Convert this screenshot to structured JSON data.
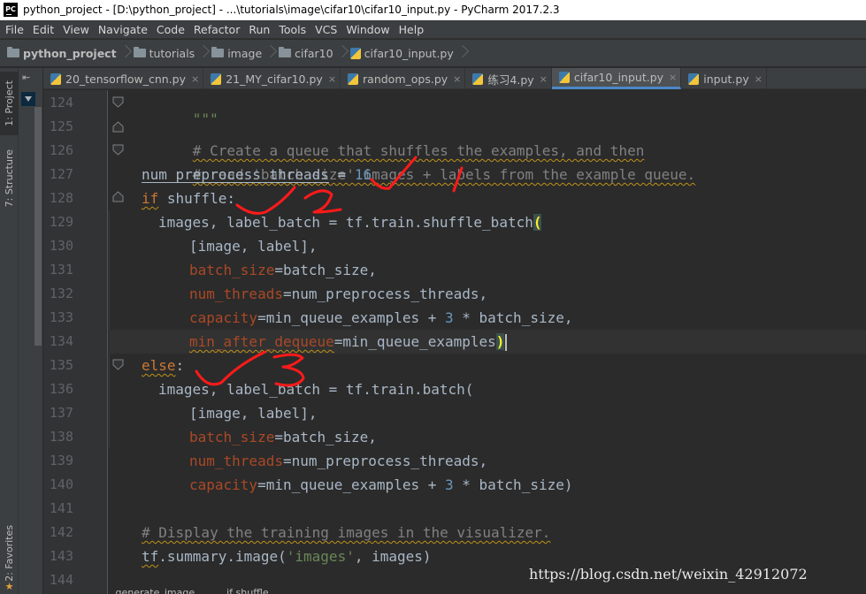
{
  "window": {
    "title": "python_project - [D:\\python_project] - ...\\tutorials\\image\\cifar10\\cifar10_input.py - PyCharm 2017.2.3",
    "logo_text": "PC"
  },
  "menu": [
    "File",
    "Edit",
    "View",
    "Navigate",
    "Code",
    "Refactor",
    "Run",
    "Tools",
    "VCS",
    "Window",
    "Help"
  ],
  "breadcrumb": [
    "python_project",
    "tutorials",
    "image",
    "cifar10",
    "cifar10_input.py"
  ],
  "tool_strip": {
    "project_tab": "1: Project",
    "structure_tab": "7: Structure",
    "favorites_tab": "2: Favorites"
  },
  "tabs": [
    {
      "label": "20_tensorflow_cnn.py",
      "active": false
    },
    {
      "label": "21_MY_cifar10.py",
      "active": false
    },
    {
      "label": "random_ops.py",
      "active": false
    },
    {
      "label": "练习4.py",
      "active": false
    },
    {
      "label": "cifar10_input.py",
      "active": true
    },
    {
      "label": "input.py",
      "active": false
    }
  ],
  "editor": {
    "line_numbers": [
      "124",
      "125",
      "126",
      "127",
      "128",
      "129",
      "130",
      "131",
      "132",
      "133",
      "134",
      "135",
      "136",
      "137",
      "138",
      "139",
      "140",
      "141",
      "142",
      "143",
      "144"
    ],
    "partial_top": "\"\"\"",
    "lines": {
      "l125": "# Create a queue that shuffles the examples, and then",
      "l126": "# read 'batch_size' images + labels from the example queue.",
      "l127_var": "num_preprocess_threads",
      "l127_op": " = ",
      "l127_num": "16",
      "l128_kw": "if",
      "l128_rest": " shuffle:",
      "l129_a": "images, label_batch = tf.train.shuffle_batch",
      "l129_b": "(",
      "l130": "[image, label],",
      "l131_p": "batch_size",
      "l131_r": "=batch_size,",
      "l132_p": "num_threads",
      "l132_r": "=num_preprocess_threads,",
      "l133_p": "capacity",
      "l133_r1": "=min_queue_examples + ",
      "l133_num": "3",
      "l133_r2": " * batch_size,",
      "l134_p": "min_after_dequeue",
      "l134_r": "=min_queue_examples",
      "l134_b": ")",
      "l135_kw": "else",
      "l135_rest": ":",
      "l136": "images, label_batch = tf.train.batch(",
      "l137": "[image, label],",
      "l138_p": "batch_size",
      "l138_r": "=batch_size,",
      "l139_p": "num_threads",
      "l139_r": "=num_preprocess_threads,",
      "l140_p": "capacity",
      "l140_r1": "=min_queue_examples + ",
      "l140_num": "3",
      "l140_r2": " * batch_size)",
      "l142": "# Display the training images in the visualizer.",
      "l143_a": "tf",
      "l143_b": ".summary.image(",
      "l143_str": "'images'",
      "l143_c": ", images)"
    }
  },
  "bottom_breadcrumb": [
    "_generate_image...",
    "if shuffle"
  ],
  "watermark": "https://blog.csdn.net/weixin_42912072",
  "colors": {
    "keyword": "#CC7832",
    "number": "#6897BB",
    "string": "#6A8759",
    "comment": "#808080",
    "param": "#AA4926",
    "text": "#A9B7C6",
    "annotation": "#FF0000"
  }
}
